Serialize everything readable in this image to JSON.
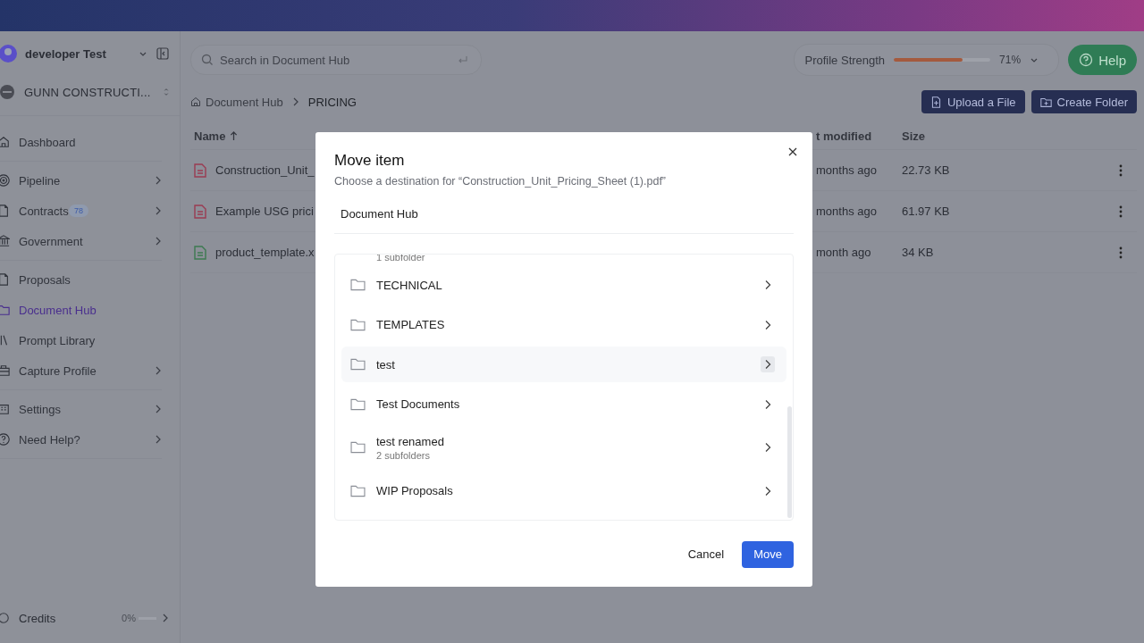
{
  "sidebar": {
    "user": "developer Test",
    "org": "GUNN CONSTRUCTI...",
    "groups": [
      [
        {
          "label": "Dashboard",
          "has_children": false,
          "selected": false
        }
      ],
      [
        {
          "label": "Pipeline",
          "has_children": true,
          "selected": false
        },
        {
          "label": "Contracts",
          "badge": "78",
          "has_children": true,
          "selected": false
        },
        {
          "label": "Government",
          "has_children": true,
          "selected": false
        }
      ],
      [
        {
          "label": "Proposals",
          "has_children": false,
          "selected": false
        },
        {
          "label": "Document Hub",
          "has_children": false,
          "selected": true
        },
        {
          "label": "Prompt Library",
          "has_children": false,
          "selected": false
        },
        {
          "label": "Capture Profile",
          "has_children": true,
          "selected": false
        }
      ],
      [
        {
          "label": "Settings",
          "has_children": true,
          "selected": false
        },
        {
          "label": "Need Help?",
          "has_children": true,
          "selected": false
        }
      ]
    ],
    "credits": {
      "label": "Credits",
      "reading": "0%",
      "level": 0
    }
  },
  "search": {
    "placeholder": "Search in Document Hub"
  },
  "profile_strength": {
    "label": "Profile Strength",
    "level": 0.71,
    "reading": "71%"
  },
  "help_button": "Help",
  "breadcrumb": [
    "Document Hub",
    "PRICING"
  ],
  "actions": [
    "Upload a File",
    "Create Folder"
  ],
  "table": {
    "columns": [
      "Name",
      "t modified",
      "Size"
    ],
    "rows": [
      {
        "name": "Construction_Unit_",
        "kind": "pdf",
        "modified": "months ago",
        "size": "22.73 KB"
      },
      {
        "name": "Example USG prici",
        "kind": "pdf",
        "modified": "months ago",
        "size": "61.97 KB"
      },
      {
        "name": "product_template.x",
        "kind": "sheet",
        "modified": "month ago",
        "size": "34 KB"
      }
    ]
  },
  "dialog": {
    "title": "Move item",
    "subtitle": "Choose a destination for “Construction_Unit_Pricing_Sheet (1).pdf”",
    "location": "Document Hub",
    "scrolled_caption": "1 subfolder",
    "folders": [
      {
        "name": "TECHNICAL",
        "hovered": false
      },
      {
        "name": "TEMPLATES",
        "hovered": false
      },
      {
        "name": "test",
        "hovered": true
      },
      {
        "name": "Test Documents",
        "hovered": false
      },
      {
        "name": "test renamed",
        "subtitle": "2 subfolders",
        "hovered": false
      },
      {
        "name": "WIP Proposals",
        "hovered": false
      }
    ],
    "buttons": [
      "Cancel",
      "Move"
    ]
  }
}
